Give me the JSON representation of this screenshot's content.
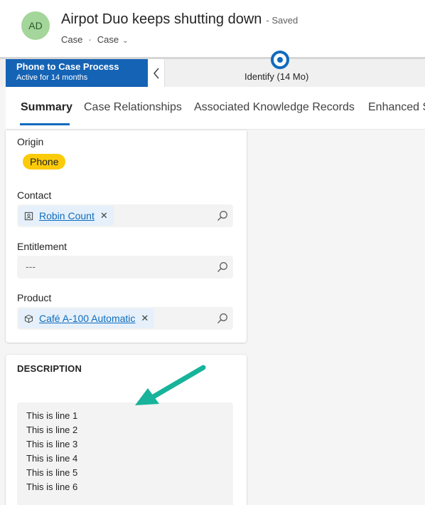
{
  "header": {
    "avatar_initials": "AD",
    "title": "Airpot Duo keeps shutting down",
    "saved_status": "- Saved",
    "entity_type": "Case",
    "form_selector": "Case"
  },
  "process": {
    "name": "Phone to Case Process",
    "active_duration": "Active for 14 months",
    "stage_label": "Identify  (14 Mo)"
  },
  "tabs": [
    {
      "label": "Summary",
      "active": true
    },
    {
      "label": "Case Relationships",
      "active": false
    },
    {
      "label": "Associated Knowledge Records",
      "active": false
    },
    {
      "label": "Enhanced S",
      "active": false
    }
  ],
  "fields": {
    "origin": {
      "label": "Origin",
      "value": "Phone"
    },
    "contact": {
      "label": "Contact",
      "value": "Robin Count"
    },
    "entitlement": {
      "label": "Entitlement",
      "value": "---"
    },
    "product": {
      "label": "Product",
      "value": "Café A-100 Automatic"
    }
  },
  "description": {
    "heading": "DESCRIPTION",
    "lines": [
      "This is line 1",
      "This is line 2",
      "This is line 3",
      "This is line 4",
      "This is line 5",
      "This is line 6"
    ]
  },
  "colors": {
    "accent": "#0f6cbd",
    "process_bg": "#1563b5",
    "avatar_bg": "#a4d59a",
    "badge_phone": "#fbcb09",
    "annotation_arrow": "#17b39a"
  },
  "icons": {
    "contact": "contact-card-icon",
    "product": "product-box-icon",
    "search": "search-icon",
    "remove": "close-icon",
    "collapse": "chevron-left-icon"
  }
}
